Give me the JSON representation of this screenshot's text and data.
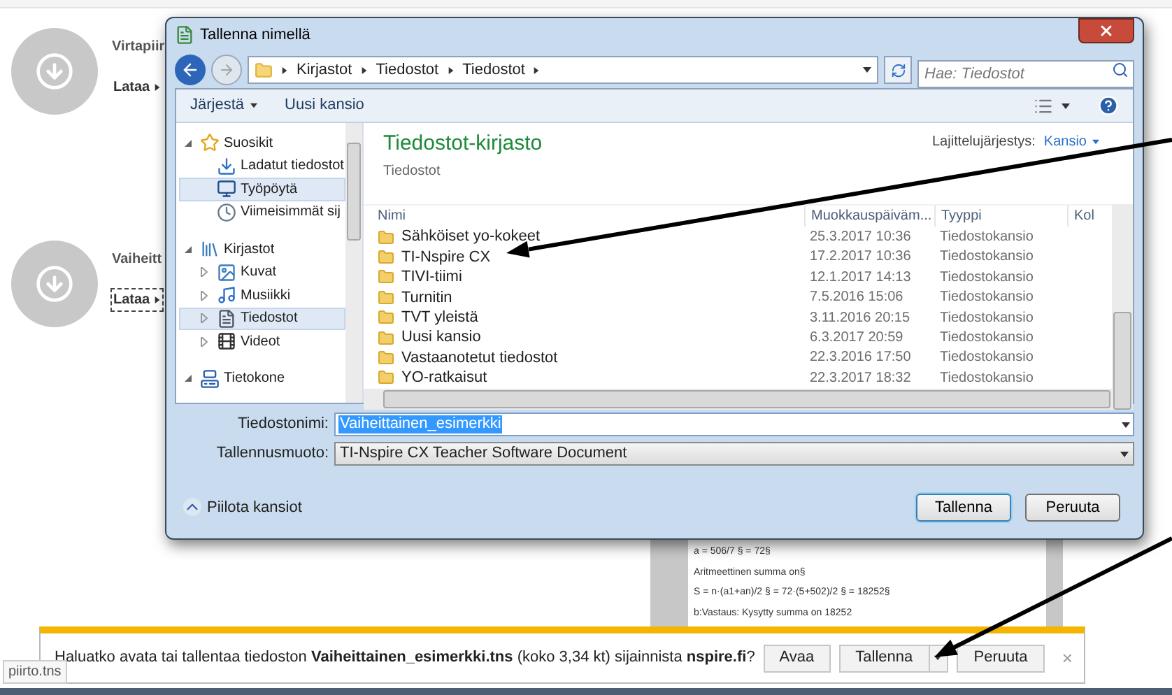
{
  "page": {
    "items": [
      {
        "title": "Virtapiir",
        "link": "Lataa",
        "focused": false
      },
      {
        "title": "Vaiheitt",
        "link": "Lataa",
        "focused": true
      }
    ]
  },
  "document_preview": {
    "lines": [
      "a = 506/7 § = 72§",
      "Aritmeettinen summa on§",
      "S = n·(a1+an)/2 § = 72·(5+502)/2 § = 18252§",
      "b:Vastaus: Kysytty summa on 18252"
    ]
  },
  "dialog": {
    "title": "Tallenna nimellä",
    "breadcrumb": [
      "Kirjastot",
      "Tiedostot",
      "Tiedostot"
    ],
    "search": {
      "placeholder": "Hae: Tiedostot"
    },
    "toolbar": [
      {
        "label": "Järjestä",
        "kind": "menu"
      },
      {
        "label": "Uusi kansio",
        "kind": "button"
      }
    ],
    "navigation": [
      {
        "label": "Suosikit",
        "kind": "favorites",
        "expanded": true,
        "selected": false,
        "children": [
          {
            "label": "Ladatut tiedostot",
            "kind": "downloads",
            "selected": false
          },
          {
            "label": "Työpöytä",
            "kind": "desktop",
            "selected": true
          },
          {
            "label": "Viimeisimmät sij",
            "kind": "recent",
            "selected": false
          }
        ]
      },
      {
        "label": "Kirjastot",
        "kind": "libraries",
        "expanded": true,
        "selected": false,
        "children": [
          {
            "label": "Kuvat",
            "kind": "pictures",
            "expanded": false,
            "selected": false
          },
          {
            "label": "Musiikki",
            "kind": "music",
            "expanded": false,
            "selected": false
          },
          {
            "label": "Tiedostot",
            "kind": "documents",
            "expanded": false,
            "selected": true
          },
          {
            "label": "Videot",
            "kind": "videos",
            "expanded": false,
            "selected": false
          }
        ]
      },
      {
        "label": "Tietokone",
        "kind": "computer",
        "expanded": true,
        "selected": false
      }
    ],
    "library": {
      "title": "Tiedostot-kirjasto",
      "subtitle": "Tiedostot",
      "sort_label": "Lajittelujärjestys:",
      "sort_value": "Kansio"
    },
    "columns": [
      "Nimi",
      "Muokkauspäiväm...",
      "Tyyppi",
      "Kol"
    ],
    "files": [
      {
        "name": "Sähköiset yo-kokeet",
        "date": "25.3.2017 10:36",
        "type": "Tiedostokansio"
      },
      {
        "name": "TI-Nspire CX",
        "date": "17.2.2017 10:36",
        "type": "Tiedostokansio"
      },
      {
        "name": "TIVI-tiimi",
        "date": "12.1.2017 14:13",
        "type": "Tiedostokansio"
      },
      {
        "name": "Turnitin",
        "date": "7.5.2016 15:06",
        "type": "Tiedostokansio"
      },
      {
        "name": "TVT yleistä",
        "date": "3.11.2016 20:15",
        "type": "Tiedostokansio"
      },
      {
        "name": "Uusi kansio",
        "date": "6.3.2017 20:59",
        "type": "Tiedostokansio"
      },
      {
        "name": "Vastaanotetut tiedostot",
        "date": "22.3.2016 17:50",
        "type": "Tiedostokansio"
      },
      {
        "name": "YO-ratkaisut",
        "date": "22.3.2017 18:32",
        "type": "Tiedostokansio"
      }
    ],
    "filename": {
      "label": "Tiedostonimi:",
      "value": "Vaiheittainen_esimerkki"
    },
    "format": {
      "label": "Tallennusmuoto:",
      "value": "TI-Nspire CX Teacher Software Document"
    },
    "hide_folders": "Piilota kansiot",
    "buttons": [
      {
        "label": "Tallenna",
        "default": true
      },
      {
        "label": "Peruuta",
        "default": false
      }
    ]
  },
  "download_bar": {
    "message": "Haluatko avata tai tallentaa tiedoston **Vaiheittainen_esimerkki.tns** (koko 3,34 kt) sijainnista **nspire.fi**?",
    "buttons": [
      {
        "label": "Avaa",
        "kind": "plain"
      },
      {
        "label": "Tallenna",
        "kind": "split"
      },
      {
        "label": "Peruuta",
        "kind": "plain"
      }
    ],
    "close": "×"
  },
  "tooltip": "piirto.tns"
}
